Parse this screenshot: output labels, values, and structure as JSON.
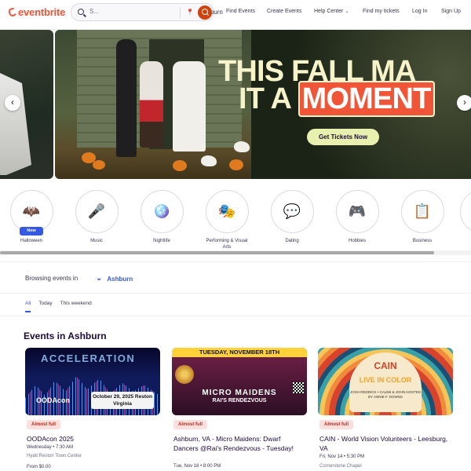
{
  "header": {
    "logo": "eventbrite",
    "search_placeholder": "S...",
    "location": "Ashburn",
    "nav": {
      "find_events": "Find Events",
      "create_events": "Create Events",
      "help_center": "Help Center",
      "find_tickets": "Find my tickets",
      "login": "Log In",
      "signup": "Sign Up"
    }
  },
  "hero": {
    "line1": "THIS FALL MA",
    "line2_a": "IT A ",
    "line2_b": "MOMENT",
    "cta": "Get Tickets Now",
    "slides_total": 5,
    "current_slide": 1
  },
  "categories": [
    {
      "label": "Halloween",
      "icon": "bat-moon-icon",
      "glyph": "🦇",
      "badge": "New"
    },
    {
      "label": "Music",
      "icon": "microphone-icon",
      "glyph": "🎤"
    },
    {
      "label": "Nightlife",
      "icon": "disco-ball-icon",
      "glyph": "🪩"
    },
    {
      "label": "Performing & Visual Arts",
      "icon": "theater-masks-icon",
      "glyph": "🎭"
    },
    {
      "label": "Dating",
      "icon": "chat-heart-icon",
      "glyph": "💬"
    },
    {
      "label": "Hobbies",
      "icon": "gamepad-icon",
      "glyph": "🎮"
    },
    {
      "label": "Business",
      "icon": "presentation-board-icon",
      "glyph": "📋"
    }
  ],
  "browse": {
    "label": "Browsing events in",
    "location": "Ashburn"
  },
  "tabs": [
    "All",
    "Today",
    "This weekend"
  ],
  "section_title": "Events in Ashburn",
  "events": [
    {
      "status": "Almost full",
      "title": "OODAcon 2025",
      "date": "Wednesday • 7:30 AM",
      "venue": "Hyatt Reston Town Center",
      "price": "From $0.00",
      "img_title": "ACCELERATION",
      "img_logo": "OODAcon",
      "img_box": "October 29, 2025 Reston Virginia"
    },
    {
      "status": "Almost full",
      "title": "Ashburn, VA - Micro Maidens: Dwarf Dancers @Rai's Rendezvous - Tuesday!",
      "date": "Tue, Nov 18 • 8:00 PM",
      "img_top": "TUESDAY, NOVEMBER 18TH",
      "img_m1": "MICRO MAIDENS",
      "img_m2": "RAI'S RENDEZVOUS"
    },
    {
      "status": "Almost full",
      "title": "CAIN - World Vision Volunteers - Leesburg, VA",
      "date": "Fri, Nov 14 • 5:30 PM",
      "venue": "Cornerstone Chapel",
      "img_cain": "CAIN",
      "img_live": "LIVE IN COLOR",
      "img_names": "JOSH REDDICK • CALEB & JOHN HOSTED BY ANNIE F. DOWNS"
    }
  ]
}
